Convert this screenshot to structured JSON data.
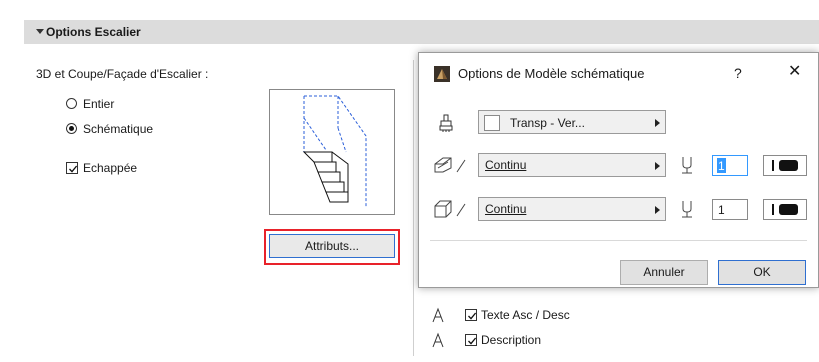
{
  "section": {
    "title": "Options Escalier"
  },
  "left_panel": {
    "group_label": "3D et Coupe/Façade d'Escalier :",
    "radio_options": [
      {
        "label": "Entier",
        "selected": false
      },
      {
        "label": "Schématique",
        "selected": true
      }
    ],
    "checkbox": {
      "label": "Echappée",
      "checked": true
    },
    "attributes_button": "Attributs..."
  },
  "dialog": {
    "title": "Options de Modèle schématique",
    "help_label": "?",
    "close_label": "✕",
    "fill_popup": {
      "value": "Transp - Ver..."
    },
    "line_rows": [
      {
        "line_type": "Continu",
        "pen_value": "1"
      },
      {
        "line_type": "Continu",
        "pen_value": "1"
      }
    ],
    "buttons": {
      "cancel": "Annuler",
      "ok": "OK"
    }
  },
  "background_options": [
    {
      "label": "Texte Asc / Desc",
      "checked": true
    },
    {
      "label": "Description",
      "checked": true
    }
  ],
  "colors": {
    "highlight": "#e8222a",
    "focus_blue": "#2f6fd0",
    "selection": "#3399ff"
  }
}
